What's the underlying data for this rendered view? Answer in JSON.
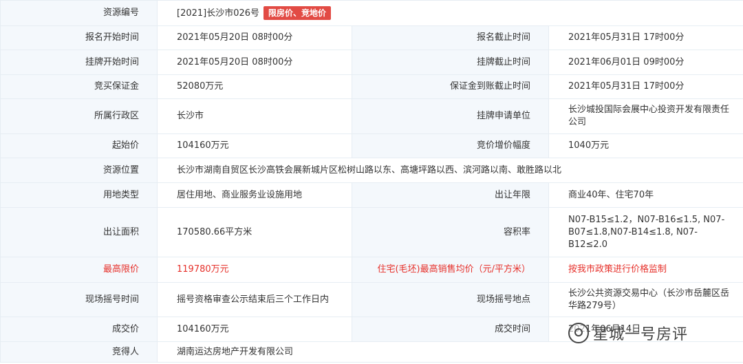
{
  "rows": {
    "r0": {
      "l1": "资源编号",
      "v1": "[2021]长沙市026号",
      "badge": "限房价、竞地价"
    },
    "r1": {
      "l1": "报名开始时间",
      "v1": "2021年05月20日 08时00分",
      "l2": "报名截止时间",
      "v2": "2021年05月31日 17时00分"
    },
    "r2": {
      "l1": "挂牌开始时间",
      "v1": "2021年05月20日 08时00分",
      "l2": "挂牌截止时间",
      "v2": "2021年06月01日 09时00分"
    },
    "r3": {
      "l1": "竞买保证金",
      "v1": "52080万元",
      "l2": "保证金到账截止时间",
      "v2": "2021年05月31日 17时00分"
    },
    "r4": {
      "l1": "所属行政区",
      "v1": "长沙市",
      "l2": "挂牌申请单位",
      "v2": "长沙城投国际会展中心投资开发有限责任公司"
    },
    "r5": {
      "l1": "起始价",
      "v1": "104160万元",
      "l2": "竞价增价幅度",
      "v2": "1040万元"
    },
    "r6": {
      "l1": "资源位置",
      "v1": "长沙市湖南自贸区长沙高铁会展新城片区松树山路以东、高塘坪路以西、滨河路以南、敢胜路以北"
    },
    "r7": {
      "l1": "用地类型",
      "v1": "居住用地、商业服务业设施用地",
      "l2": "出让年限",
      "v2": "商业40年、住宅70年"
    },
    "r8": {
      "l1": "出让面积",
      "v1": "170580.66平方米",
      "l2": "容积率",
      "v2": "N07-B15≤1.2，N07-B16≤1.5, N07-B07≤1.8,N07-B14≤1.8, N07-B12≤2.0"
    },
    "r9": {
      "l1": "最高限价",
      "v1": "119780万元",
      "l2": "住宅(毛坯)最高销售均价（元/平方米）",
      "v2": "按我市政策进行价格监制"
    },
    "r10": {
      "l1": "现场摇号时间",
      "v1": "摇号资格审查公示结束后三个工作日内",
      "l2": "现场摇号地点",
      "v2": "长沙公共资源交易中心（长沙市岳麓区岳华路279号）"
    },
    "r11": {
      "l1": "成交价",
      "v1": "104160万元",
      "l2": "成交时间",
      "v2": "2021年06月14日"
    },
    "r12": {
      "l1": "竞得人",
      "v1": "湖南运达房地产开发有限公司"
    }
  },
  "watermark": {
    "text": "星城一号房评",
    "icon": "wechat-logo-icon"
  },
  "colors": {
    "label_bg": "#f4f8fc",
    "border": "#e6edf3",
    "red": "#e6302a",
    "badge_bg": "#e24b44"
  }
}
